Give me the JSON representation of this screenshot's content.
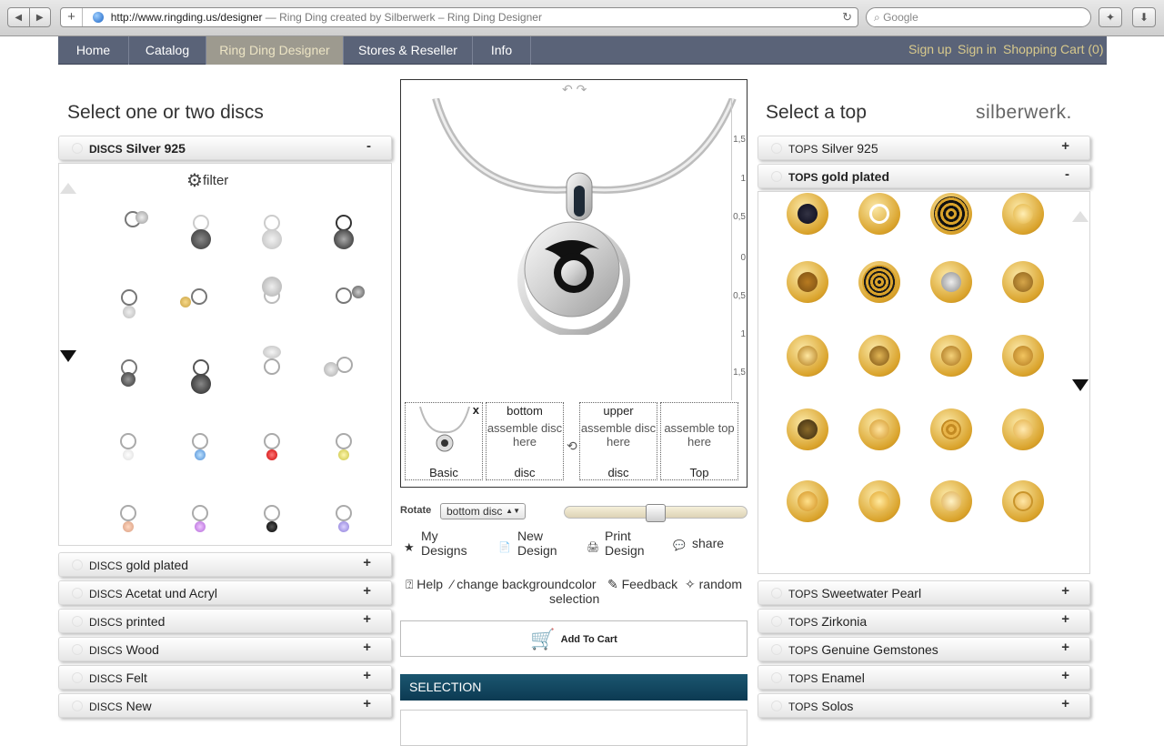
{
  "browser": {
    "url": "http://www.ringding.us/designer",
    "title": "— Ring Ding created by Silberwerk – Ring Ding Designer",
    "search_placeholder": "Google",
    "back": "◀",
    "forward": "▶",
    "new_tab": "+",
    "reload": "↻"
  },
  "nav": {
    "items": [
      "Home",
      "Catalog",
      "Ring Ding Designer",
      "Stores & Reseller",
      "Info"
    ],
    "right": [
      "Sign up",
      "Sign in",
      "Shopping Cart (0)"
    ]
  },
  "left": {
    "heading": "Select one or two discs",
    "filter": "filter",
    "open_section": {
      "prefix": "DISCS",
      "name": "Silver 925",
      "toggle": "-"
    },
    "sections": [
      {
        "prefix": "DISCS",
        "name": "gold plated",
        "toggle": "+"
      },
      {
        "prefix": "DISCS",
        "name": "Acetat und Acryl",
        "toggle": "+"
      },
      {
        "prefix": "DISCS",
        "name": "printed",
        "toggle": "+"
      },
      {
        "prefix": "DISCS",
        "name": "Wood",
        "toggle": "+"
      },
      {
        "prefix": "DISCS",
        "name": "Felt",
        "toggle": "+"
      },
      {
        "prefix": "DISCS",
        "name": "New",
        "toggle": "+"
      }
    ]
  },
  "right": {
    "heading": "Select a top",
    "brand": "silberwerk.",
    "sections_above": [
      {
        "prefix": "TOPS",
        "name": "Silver 925",
        "toggle": "+"
      }
    ],
    "open_section": {
      "prefix": "TOPS",
      "name": "gold plated",
      "toggle": "-"
    },
    "sections": [
      {
        "prefix": "TOPS",
        "name": "Sweetwater Pearl",
        "toggle": "+"
      },
      {
        "prefix": "TOPS",
        "name": "Zirkonia",
        "toggle": "+"
      },
      {
        "prefix": "TOPS",
        "name": "Genuine Gemstones",
        "toggle": "+"
      },
      {
        "prefix": "TOPS",
        "name": "Enamel",
        "toggle": "+"
      },
      {
        "prefix": "TOPS",
        "name": "Solos",
        "toggle": "+"
      }
    ]
  },
  "stage": {
    "undo": "↶ ↷",
    "scale": [
      "1,5",
      "1",
      "0,5",
      "0",
      "0,5",
      "1",
      "1,5"
    ],
    "slots": {
      "basic": {
        "label": "Basic",
        "close": "x"
      },
      "bottom": {
        "caption": "bottom",
        "hint": "assemble disc here",
        "label": "disc"
      },
      "swap": "⟲",
      "upper": {
        "caption": "upper",
        "hint": "assemble disc here",
        "label": "disc"
      },
      "top": {
        "hint": "assemble top here",
        "label": "Top"
      }
    }
  },
  "controls": {
    "rotate_label": "Rotate",
    "rotate_value": "bottom disc",
    "slider_value": 0.5,
    "actions": [
      {
        "label_line1": "My",
        "label_line2": "Designs",
        "icon": "★"
      },
      {
        "label_line1": "New",
        "label_line2": "Design",
        "icon": "📄"
      },
      {
        "label_line1": "Print",
        "label_line2": "Design",
        "icon": "🖨"
      },
      {
        "label_line1": "share",
        "label_line2": "",
        "icon": "💬"
      }
    ],
    "help": "Help",
    "background": "change backgroundcolor",
    "feedback": "Feedback",
    "random": "random",
    "selection_word": "selection",
    "add_to_cart": "Add To Cart"
  },
  "selection": {
    "heading": "SELECTION"
  },
  "colors": {
    "nav_bg": "#5a6378",
    "nav_active": "#9d9a8f",
    "nav_link": "#d8c98c",
    "selection_bar": "#0c3a52",
    "gold": "#d9a22a",
    "silver": "#cfcfcf"
  }
}
